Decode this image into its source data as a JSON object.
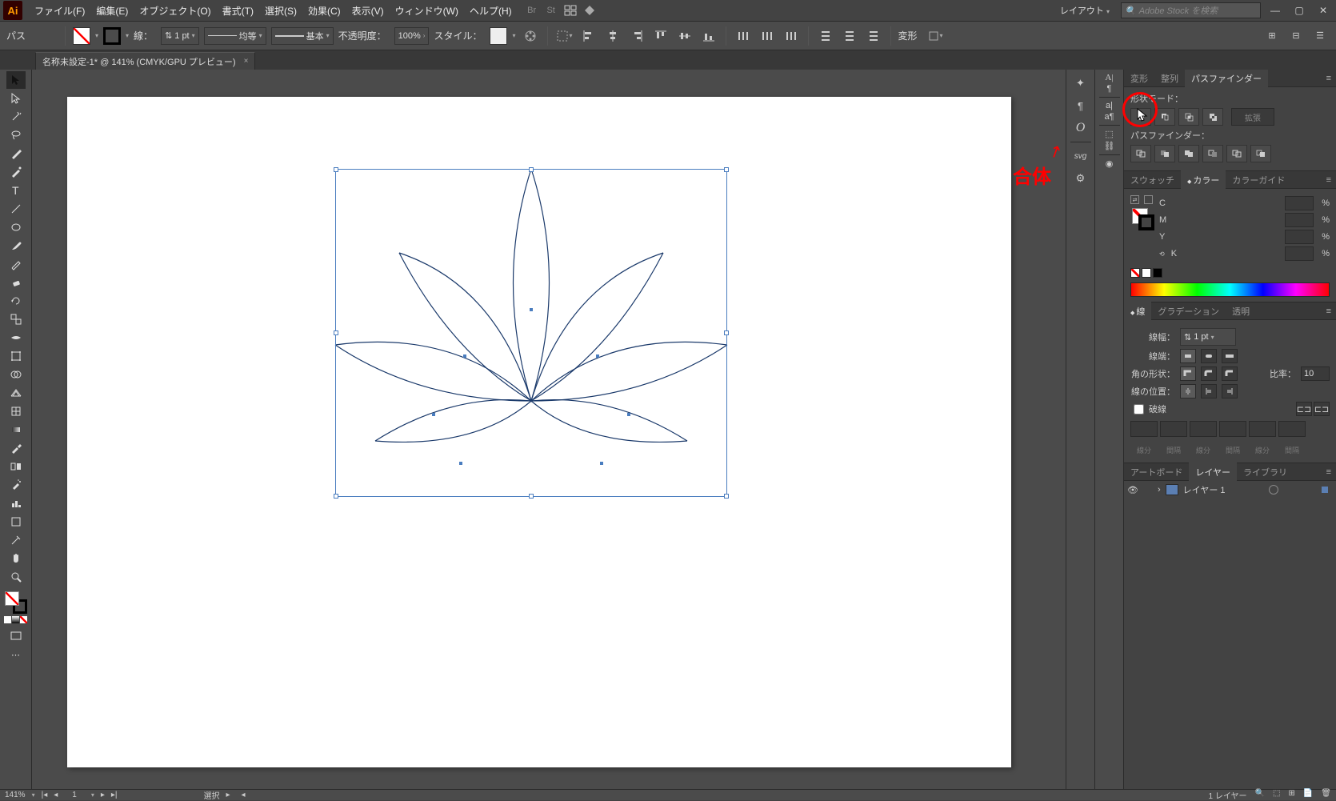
{
  "app": {
    "icon_text": "Ai"
  },
  "menus": {
    "file": "ファイル(F)",
    "edit": "編集(E)",
    "object": "オブジェクト(O)",
    "type": "書式(T)",
    "select": "選択(S)",
    "effect": "効果(C)",
    "view": "表示(V)",
    "window": "ウィンドウ(W)",
    "help": "ヘルプ(H)"
  },
  "topright": {
    "layout": "レイアウト",
    "search_placeholder": "Adobe Stock を検索"
  },
  "controlbar": {
    "sel_type": "パス",
    "stroke_label": "線：",
    "stroke_weight": "1 pt",
    "profile": "均等",
    "brush": "基本",
    "opacity_label": "不透明度：",
    "opacity": "100%",
    "style_label": "スタイル：",
    "transform": "変形"
  },
  "document": {
    "tab": "名称未設定-1* @ 141% (CMYK/GPU プレビュー)"
  },
  "annotation": {
    "text": "合体"
  },
  "pathfinder": {
    "tab_transform": "変形",
    "tab_align": "整列",
    "tab_pathfinder": "パスファインダー",
    "shape_modes": "形状モード：",
    "pathfinder_label": "パスファインダー：",
    "expand": "拡張"
  },
  "color": {
    "tab_swatch": "スウォッチ",
    "tab_color": "カラー",
    "tab_guide": "カラーガイド",
    "c": "C",
    "m": "M",
    "y": "Y",
    "k": "K",
    "pct": "%"
  },
  "stroke": {
    "tab_stroke": "線",
    "tab_grad": "グラデーション",
    "tab_transp": "透明",
    "weight_label": "線幅：",
    "weight": "1 pt",
    "cap_label": "線端：",
    "corner_label": "角の形状：",
    "ratio_label": "比率：",
    "ratio": "10",
    "align_label": "線の位置：",
    "dashed": "破線",
    "dash_labels": [
      "線分",
      "間隔",
      "線分",
      "間隔",
      "線分",
      "間隔"
    ]
  },
  "layers": {
    "tab_artboards": "アートボード",
    "tab_layers": "レイヤー",
    "tab_libraries": "ライブラリ",
    "layer1": "レイヤー 1"
  },
  "status": {
    "zoom": "141%",
    "artboard_nav": "1",
    "sel": "選択",
    "layers_count": "1 レイヤー"
  }
}
